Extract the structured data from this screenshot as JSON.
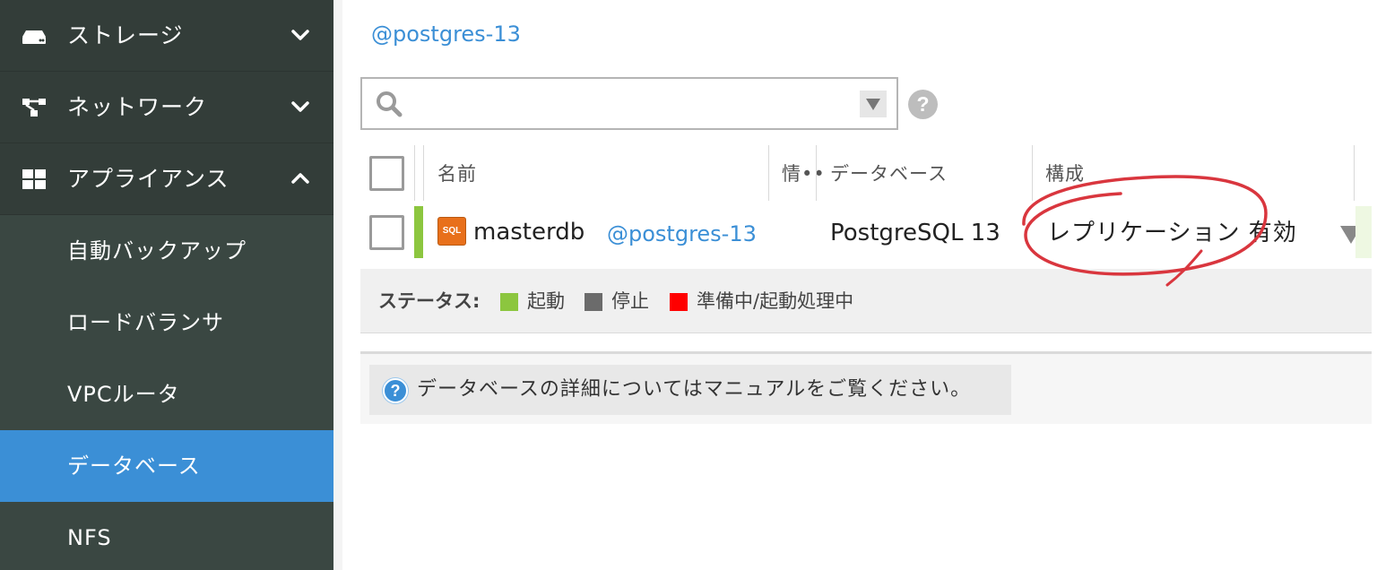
{
  "sidebar": {
    "categories": [
      {
        "label": "ストレージ",
        "icon": "storage-icon",
        "chevron": "chevron-down-icon"
      },
      {
        "label": "ネットワーク",
        "icon": "network-icon",
        "chevron": "chevron-down-icon"
      },
      {
        "label": "アプライアンス",
        "icon": "appliance-grid-icon",
        "chevron": "chevron-up-icon"
      }
    ],
    "items": [
      {
        "label": "自動バックアップ",
        "active": false
      },
      {
        "label": "ロードバランサ",
        "active": false
      },
      {
        "label": "VPCルータ",
        "active": false
      },
      {
        "label": "データベース",
        "active": true
      },
      {
        "label": "NFS",
        "active": false
      }
    ]
  },
  "main": {
    "breadcrumb": "@postgres-13",
    "search": {
      "placeholder": "",
      "value": ""
    },
    "help": "?",
    "table": {
      "headers": {
        "name": "名前",
        "info": "情••",
        "database": "データベース",
        "config": "構成"
      },
      "rows": [
        {
          "icon_text": "SQL",
          "name": "masterdb",
          "tag": "@postgres-13",
          "database": "PostgreSQL 13",
          "config": "レプリケーション 有効",
          "status": "running"
        }
      ]
    },
    "legend": {
      "title": "ステータス:",
      "items": [
        {
          "label": "起動",
          "color": "#8cc63f"
        },
        {
          "label": "停止",
          "color": "#6b6b6b"
        },
        {
          "label": "準備中/起動処理中",
          "color": "#ff0000"
        }
      ]
    },
    "info": {
      "icon": "?",
      "text": "データベースの詳細についてはマニュアルをご覧ください。"
    }
  },
  "colors": {
    "sidebar_bg": "#3a4742",
    "active_item": "#3b8fd6",
    "link": "#3b8fd6",
    "annotation": "#d9363e"
  }
}
